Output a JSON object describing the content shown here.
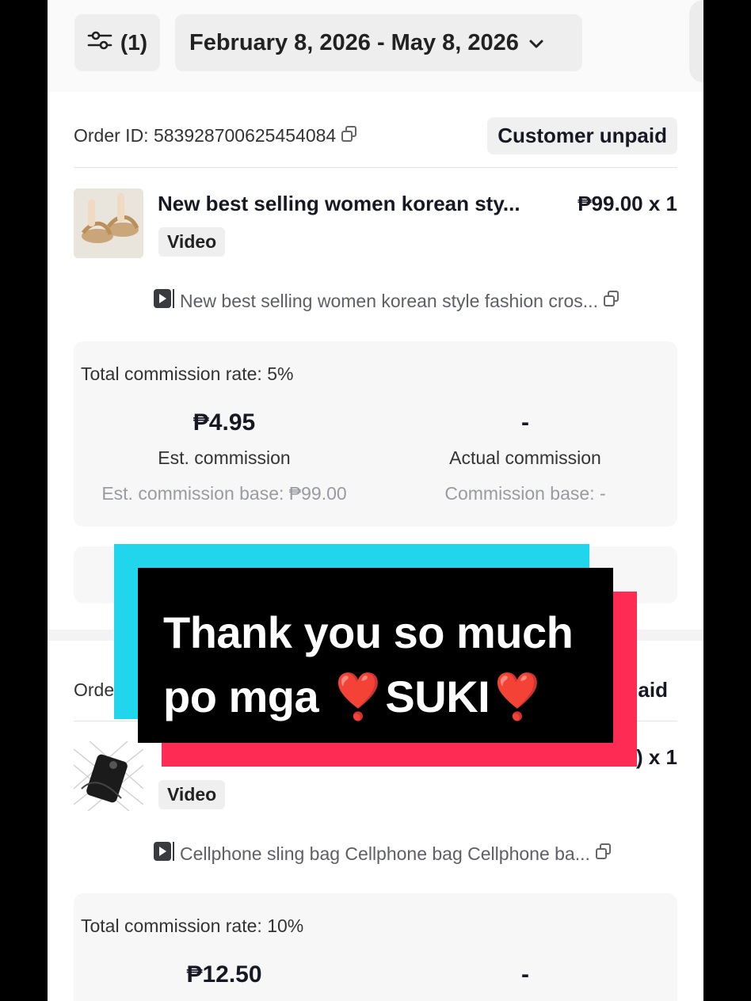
{
  "filters": {
    "count_label": "(1)",
    "date_range": "February 8, 2026 - May 8, 2026"
  },
  "orders": [
    {
      "order_id_label": "Order ID: 583928700625454084",
      "status": "Customer unpaid",
      "product_title": "New best selling women korean sty...",
      "price": "₱99.00 x 1",
      "tag": "Video",
      "video_title": "New best selling women korean style fashion cros...",
      "commission_rate": "Total commission rate: 5%",
      "est_commission": "₱4.95",
      "est_commission_label": "Est. commission",
      "est_base": "Est. commission base: ₱99.00",
      "actual_commission": "-",
      "actual_commission_label": "Actual commission",
      "actual_base": "Commission base: -"
    },
    {
      "order_id_label": "Orde",
      "status": "aid",
      "price": ") x 1",
      "tag": "Video",
      "video_title": "Cellphone sling bag Cellphone bag Cellphone ba...",
      "commission_rate": "Total commission rate: 10%",
      "est_commission": "₱12.50",
      "actual_commission": "-"
    }
  ],
  "caption": {
    "line1": "Thank you so much",
    "line2": "po mga ❣️SUKI❣️"
  },
  "icons": [
    "filter-icon",
    "chevron-down-icon",
    "copy-icon",
    "video-icon"
  ],
  "colors": {
    "caption_bg": "#000000",
    "caption_cyan": "#20d5ec",
    "caption_red": "#fe2c55"
  }
}
